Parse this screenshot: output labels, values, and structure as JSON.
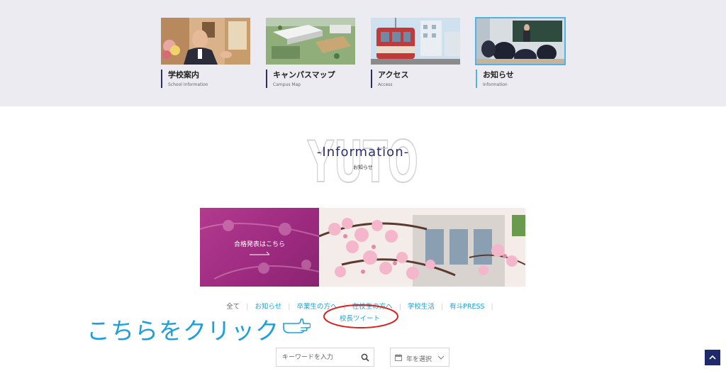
{
  "nav_cards": [
    {
      "title": "学校案内",
      "subtitle": "School Information",
      "active": false
    },
    {
      "title": "キャンパスマップ",
      "subtitle": "Campus Map",
      "active": false
    },
    {
      "title": "アクセス",
      "subtitle": "Access",
      "active": false
    },
    {
      "title": "お知らせ",
      "subtitle": "Information",
      "active": true
    }
  ],
  "section": {
    "background_word": "YUTO",
    "heading": "-Information-",
    "subheading": "お知らせ"
  },
  "banner": {
    "label": "合格発表はこちら"
  },
  "filters": {
    "items": [
      "全て",
      "お知らせ",
      "卒業生の方へ",
      "在校生の方へ",
      "学校生活",
      "有斗PRESS"
    ],
    "second_row": "校長ツイート"
  },
  "annotation": {
    "text": "こちらをクリック"
  },
  "search": {
    "placeholder": "キーワードを入力"
  },
  "year_select": {
    "label": "年を選択"
  },
  "colors": {
    "accent": "#1aa2d8",
    "navy": "#2a2f6b",
    "banner_magenta": "#a3307f",
    "annotation_red": "#d8231f"
  },
  "icons": {
    "search": "search-icon",
    "calendar": "calendar-icon",
    "chevron": "chevron-down-icon",
    "back_to_top": "chevron-up-icon"
  }
}
